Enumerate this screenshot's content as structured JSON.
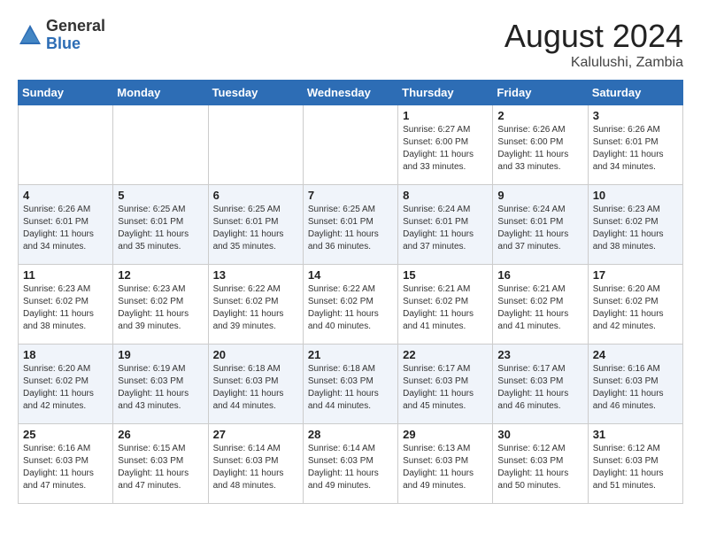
{
  "logo": {
    "general": "General",
    "blue": "Blue"
  },
  "title": "August 2024",
  "location": "Kalulushi, Zambia",
  "days_of_week": [
    "Sunday",
    "Monday",
    "Tuesday",
    "Wednesday",
    "Thursday",
    "Friday",
    "Saturday"
  ],
  "weeks": [
    [
      {
        "day": "",
        "info": ""
      },
      {
        "day": "",
        "info": ""
      },
      {
        "day": "",
        "info": ""
      },
      {
        "day": "",
        "info": ""
      },
      {
        "day": "1",
        "info": "Sunrise: 6:27 AM\nSunset: 6:00 PM\nDaylight: 11 hours\nand 33 minutes."
      },
      {
        "day": "2",
        "info": "Sunrise: 6:26 AM\nSunset: 6:00 PM\nDaylight: 11 hours\nand 33 minutes."
      },
      {
        "day": "3",
        "info": "Sunrise: 6:26 AM\nSunset: 6:01 PM\nDaylight: 11 hours\nand 34 minutes."
      }
    ],
    [
      {
        "day": "4",
        "info": "Sunrise: 6:26 AM\nSunset: 6:01 PM\nDaylight: 11 hours\nand 34 minutes."
      },
      {
        "day": "5",
        "info": "Sunrise: 6:25 AM\nSunset: 6:01 PM\nDaylight: 11 hours\nand 35 minutes."
      },
      {
        "day": "6",
        "info": "Sunrise: 6:25 AM\nSunset: 6:01 PM\nDaylight: 11 hours\nand 35 minutes."
      },
      {
        "day": "7",
        "info": "Sunrise: 6:25 AM\nSunset: 6:01 PM\nDaylight: 11 hours\nand 36 minutes."
      },
      {
        "day": "8",
        "info": "Sunrise: 6:24 AM\nSunset: 6:01 PM\nDaylight: 11 hours\nand 37 minutes."
      },
      {
        "day": "9",
        "info": "Sunrise: 6:24 AM\nSunset: 6:01 PM\nDaylight: 11 hours\nand 37 minutes."
      },
      {
        "day": "10",
        "info": "Sunrise: 6:23 AM\nSunset: 6:02 PM\nDaylight: 11 hours\nand 38 minutes."
      }
    ],
    [
      {
        "day": "11",
        "info": "Sunrise: 6:23 AM\nSunset: 6:02 PM\nDaylight: 11 hours\nand 38 minutes."
      },
      {
        "day": "12",
        "info": "Sunrise: 6:23 AM\nSunset: 6:02 PM\nDaylight: 11 hours\nand 39 minutes."
      },
      {
        "day": "13",
        "info": "Sunrise: 6:22 AM\nSunset: 6:02 PM\nDaylight: 11 hours\nand 39 minutes."
      },
      {
        "day": "14",
        "info": "Sunrise: 6:22 AM\nSunset: 6:02 PM\nDaylight: 11 hours\nand 40 minutes."
      },
      {
        "day": "15",
        "info": "Sunrise: 6:21 AM\nSunset: 6:02 PM\nDaylight: 11 hours\nand 41 minutes."
      },
      {
        "day": "16",
        "info": "Sunrise: 6:21 AM\nSunset: 6:02 PM\nDaylight: 11 hours\nand 41 minutes."
      },
      {
        "day": "17",
        "info": "Sunrise: 6:20 AM\nSunset: 6:02 PM\nDaylight: 11 hours\nand 42 minutes."
      }
    ],
    [
      {
        "day": "18",
        "info": "Sunrise: 6:20 AM\nSunset: 6:02 PM\nDaylight: 11 hours\nand 42 minutes."
      },
      {
        "day": "19",
        "info": "Sunrise: 6:19 AM\nSunset: 6:03 PM\nDaylight: 11 hours\nand 43 minutes."
      },
      {
        "day": "20",
        "info": "Sunrise: 6:18 AM\nSunset: 6:03 PM\nDaylight: 11 hours\nand 44 minutes."
      },
      {
        "day": "21",
        "info": "Sunrise: 6:18 AM\nSunset: 6:03 PM\nDaylight: 11 hours\nand 44 minutes."
      },
      {
        "day": "22",
        "info": "Sunrise: 6:17 AM\nSunset: 6:03 PM\nDaylight: 11 hours\nand 45 minutes."
      },
      {
        "day": "23",
        "info": "Sunrise: 6:17 AM\nSunset: 6:03 PM\nDaylight: 11 hours\nand 46 minutes."
      },
      {
        "day": "24",
        "info": "Sunrise: 6:16 AM\nSunset: 6:03 PM\nDaylight: 11 hours\nand 46 minutes."
      }
    ],
    [
      {
        "day": "25",
        "info": "Sunrise: 6:16 AM\nSunset: 6:03 PM\nDaylight: 11 hours\nand 47 minutes."
      },
      {
        "day": "26",
        "info": "Sunrise: 6:15 AM\nSunset: 6:03 PM\nDaylight: 11 hours\nand 47 minutes."
      },
      {
        "day": "27",
        "info": "Sunrise: 6:14 AM\nSunset: 6:03 PM\nDaylight: 11 hours\nand 48 minutes."
      },
      {
        "day": "28",
        "info": "Sunrise: 6:14 AM\nSunset: 6:03 PM\nDaylight: 11 hours\nand 49 minutes."
      },
      {
        "day": "29",
        "info": "Sunrise: 6:13 AM\nSunset: 6:03 PM\nDaylight: 11 hours\nand 49 minutes."
      },
      {
        "day": "30",
        "info": "Sunrise: 6:12 AM\nSunset: 6:03 PM\nDaylight: 11 hours\nand 50 minutes."
      },
      {
        "day": "31",
        "info": "Sunrise: 6:12 AM\nSunset: 6:03 PM\nDaylight: 11 hours\nand 51 minutes."
      }
    ]
  ]
}
